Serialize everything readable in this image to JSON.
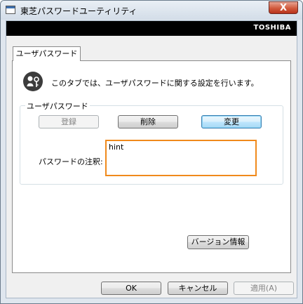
{
  "window": {
    "title": "東芝パスワードユーティリティ",
    "close_label": "X"
  },
  "banner": {
    "brand": "TOSHIBA"
  },
  "tab": {
    "label": "ユーザパスワード"
  },
  "panel": {
    "description": "このタブでは、ユーザパスワードに関する設定を行います。"
  },
  "group": {
    "label": "ユーザパスワード",
    "register_label": "登録",
    "delete_label": "削除",
    "change_label": "変更",
    "note_label": "パスワードの注釈:",
    "note_value": "hint"
  },
  "version_button": "バージョン情報",
  "footer": {
    "ok_label": "OK",
    "cancel_label": "キャンセル",
    "apply_label": "適用(A)"
  },
  "colors": {
    "highlight": "#f08a1c",
    "banner": "#000000"
  },
  "icons": {
    "app": "window-app-icon",
    "user": "user-key-icon"
  }
}
